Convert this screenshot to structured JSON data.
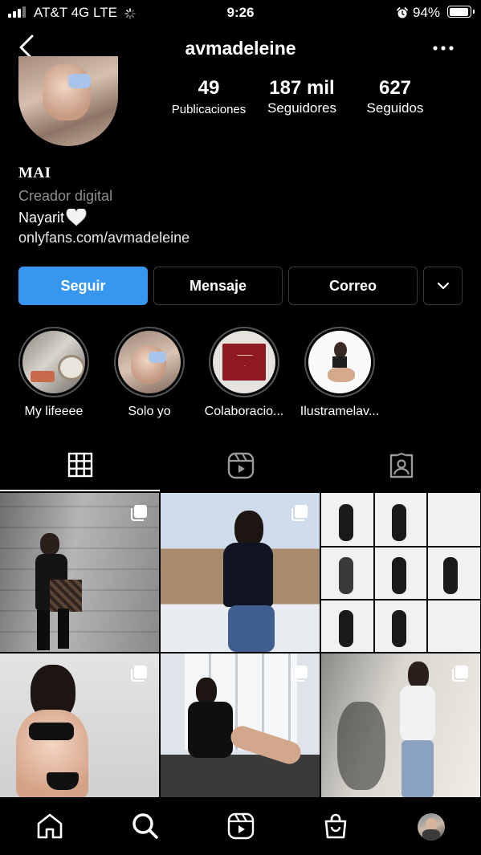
{
  "status_bar": {
    "carrier": "AT&T 4G  LTE",
    "time": "9:26",
    "battery_pct": "94%",
    "battery_level": 0.94
  },
  "header": {
    "username": "avmadeleine"
  },
  "profile": {
    "stats": [
      {
        "value": "49",
        "label": "Publicaciones"
      },
      {
        "value": "187 mil",
        "label": "Seguidores"
      },
      {
        "value": "627",
        "label": "Seguidos"
      }
    ],
    "name": "MAI",
    "category": "Creador digital",
    "bio_line": "Nayarit",
    "bio_emoji": "🤍",
    "link": "onlyfans.com/avmadeleine"
  },
  "actions": {
    "follow": "Seguir",
    "message": "Mensaje",
    "email": "Correo"
  },
  "highlights": [
    {
      "label": "My lifeeee"
    },
    {
      "label": "Solo yo"
    },
    {
      "label": "Colaboracio..."
    },
    {
      "label": "Ilustramelav..."
    }
  ],
  "tabs": [
    "grid-icon",
    "reels-icon",
    "tagged-icon"
  ],
  "nav": [
    "home-icon",
    "search-icon",
    "reels-icon",
    "shop-icon",
    "profile-avatar"
  ],
  "colors": {
    "accent": "#3797f0",
    "background": "#000000",
    "secondary_text": "#8e8e8e"
  }
}
